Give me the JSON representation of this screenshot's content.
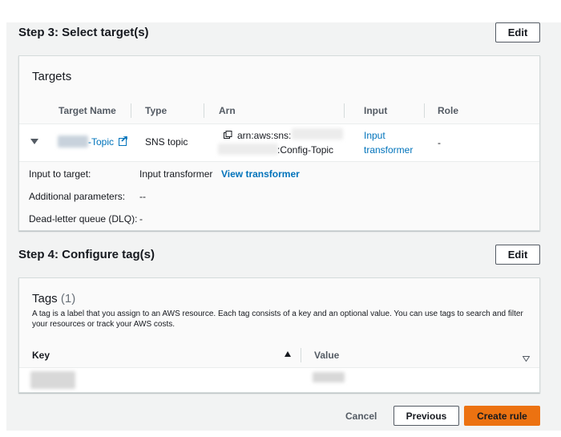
{
  "step3": {
    "title": "Step 3: Select target(s)",
    "edit_label": "Edit",
    "panel_title": "Targets",
    "columns": [
      "Target Name",
      "Type",
      "Arn",
      "Input",
      "Role"
    ],
    "row": {
      "target_name_suffix": "-Topic",
      "type": "SNS topic",
      "arn_line1": "arn:aws:sns:",
      "arn_line2": ":Config-Topic",
      "input_line1": "Input",
      "input_line2": "transformer",
      "role": "-"
    },
    "details": {
      "input_to_target_label": "Input to target:",
      "input_to_target_value": "Input transformer",
      "view_transformer_label": "View transformer",
      "additional_params_label": "Additional parameters:",
      "additional_params_value": "--",
      "dlq_label": "Dead-letter queue (DLQ):",
      "dlq_value": "-"
    }
  },
  "step4": {
    "title": "Step 4: Configure tag(s)",
    "edit_label": "Edit",
    "panel_title": "Tags",
    "count": "(1)",
    "description": "A tag is a label that you assign to an AWS resource. Each tag consists of a key and an optional value. You can use tags to search and filter your resources or track your AWS costs.",
    "key_header": "Key",
    "value_header": "Value"
  },
  "footer": {
    "cancel_label": "Cancel",
    "previous_label": "Previous",
    "create_label": "Create rule"
  },
  "colors": {
    "primary": "#ec7211",
    "link": "#0073bb",
    "background": "#f2f3f3"
  }
}
